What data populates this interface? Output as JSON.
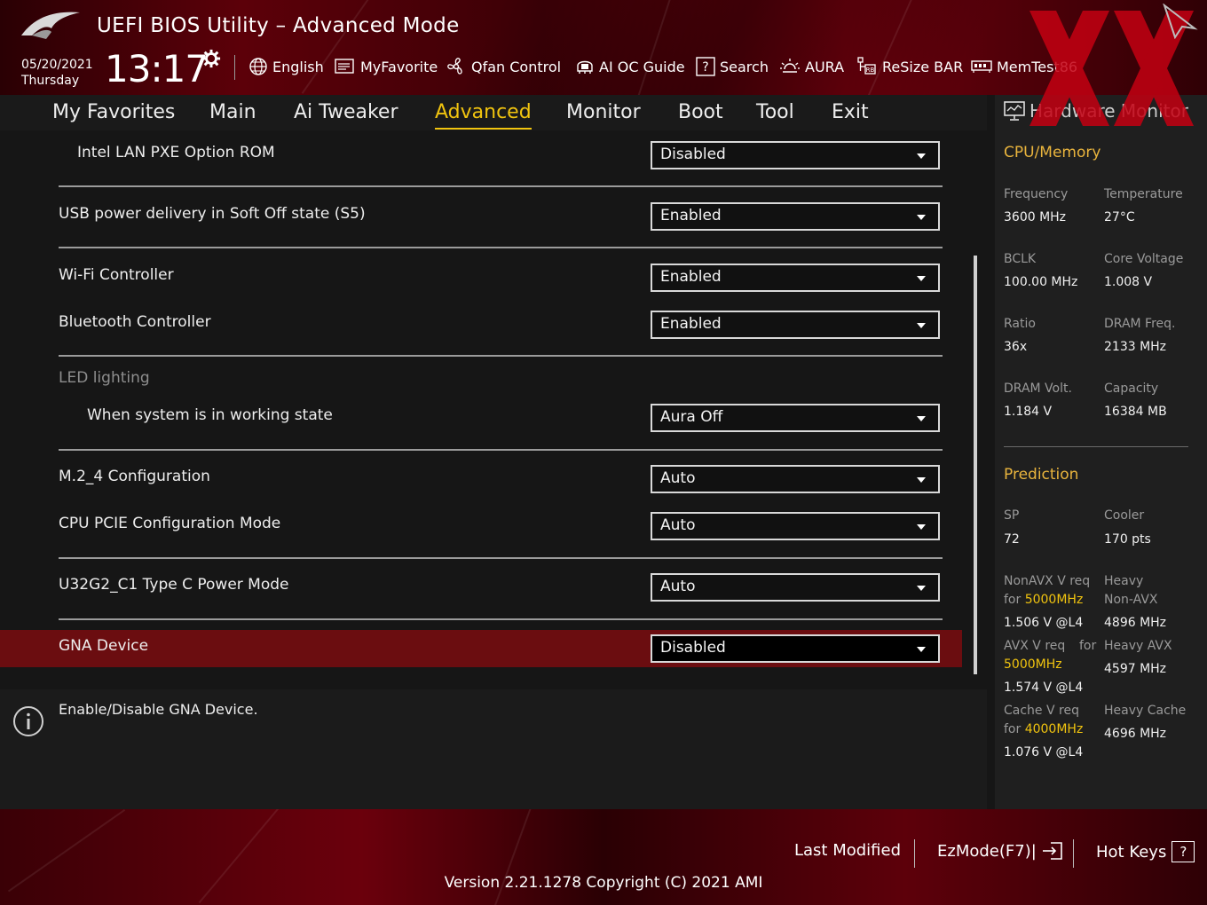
{
  "header": {
    "title": "UEFI BIOS Utility – Advanced Mode",
    "date": "05/20/2021",
    "weekday": "Thursday",
    "time": "13:17"
  },
  "toolbar": [
    {
      "label": "English",
      "icon": "globe-icon"
    },
    {
      "label": "MyFavorite",
      "icon": "favorite-icon"
    },
    {
      "label": "Qfan Control",
      "icon": "fan-icon"
    },
    {
      "label": "AI OC Guide",
      "icon": "ai-chip-icon"
    },
    {
      "label": "Search",
      "icon": "search-icon"
    },
    {
      "label": "AURA",
      "icon": "aura-icon"
    },
    {
      "label": "ReSize BAR",
      "icon": "resize-bar-icon"
    },
    {
      "label": "MemTest86",
      "icon": "memtest-icon"
    }
  ],
  "tabs": [
    {
      "label": "My Favorites"
    },
    {
      "label": "Main"
    },
    {
      "label": "Ai Tweaker"
    },
    {
      "label": "Advanced"
    },
    {
      "label": "Monitor"
    },
    {
      "label": "Boot"
    },
    {
      "label": "Tool"
    },
    {
      "label": "Exit"
    }
  ],
  "settings": {
    "lan_pxe": {
      "label": "Intel LAN PXE Option ROM",
      "value": "Disabled"
    },
    "usb_power": {
      "label": "USB power delivery in Soft Off state (S5)",
      "value": "Enabled"
    },
    "wifi": {
      "label": "Wi-Fi Controller",
      "value": "Enabled"
    },
    "bluetooth": {
      "label": "Bluetooth Controller",
      "value": "Enabled"
    },
    "led_group": "LED lighting",
    "led_working": {
      "label": "When system is in working state",
      "value": "Aura Off"
    },
    "m2_4": {
      "label": "M.2_4 Configuration",
      "value": "Auto"
    },
    "cpu_pcie": {
      "label": "CPU PCIE Configuration Mode",
      "value": "Auto"
    },
    "u32g2": {
      "label": "U32G2_C1 Type C Power Mode",
      "value": "Auto"
    },
    "gna": {
      "label": "GNA Device",
      "value": "Disabled"
    }
  },
  "help_text": "Enable/Disable GNA Device.",
  "hw_monitor": {
    "title": "Hardware Monitor",
    "cpu_memory": "CPU/Memory",
    "frequency_label": "Frequency",
    "frequency": "3600 MHz",
    "temperature_label": "Temperature",
    "temperature": "27°C",
    "bclk_label": "BCLK",
    "bclk": "100.00 MHz",
    "core_voltage_label": "Core Voltage",
    "core_voltage": "1.008 V",
    "ratio_label": "Ratio",
    "ratio": "36x",
    "dram_freq_label": "DRAM Freq.",
    "dram_freq": "2133 MHz",
    "dram_volt_label": "DRAM Volt.",
    "dram_volt": "1.184 V",
    "capacity_label": "Capacity",
    "capacity": "16384 MB",
    "prediction": "Prediction",
    "sp_label": "SP",
    "sp": "72",
    "cooler_label": "Cooler",
    "cooler": "170 pts",
    "nonavx_label_1": "NonAVX V req",
    "nonavx_for": "for ",
    "nonavx_freq": "5000MHz",
    "nonavx_v": "1.506 V @L4",
    "heavy_label_1": "Heavy",
    "heavy_label_2": "Non-AVX",
    "heavy_nonavx": "4896 MHz",
    "avx_label_1": "AVX V req",
    "avx_for": "for",
    "avx_freq": "5000MHz",
    "avx_v": "1.574 V @L4",
    "heavy_avx_label": "Heavy AVX",
    "heavy_avx": "4597 MHz",
    "cache_label_1": "Cache V req",
    "cache_for": "for ",
    "cache_freq": "4000MHz",
    "cache_v": "1.076 V @L4",
    "heavy_cache_label": "Heavy Cache",
    "heavy_cache": "4696 MHz"
  },
  "footer": {
    "last_modified": "Last Modified",
    "ezmode": "EzMode(F7)|",
    "hotkeys": "Hot Keys",
    "hotkeys_key": "?",
    "version": "Version 2.21.1278 Copyright (C) 2021 AMI"
  },
  "colors": {
    "accent": "#f1c40f",
    "section": "#e9b43d",
    "highlight_row": "#6b0d10",
    "brand_red": "#6d000c"
  }
}
